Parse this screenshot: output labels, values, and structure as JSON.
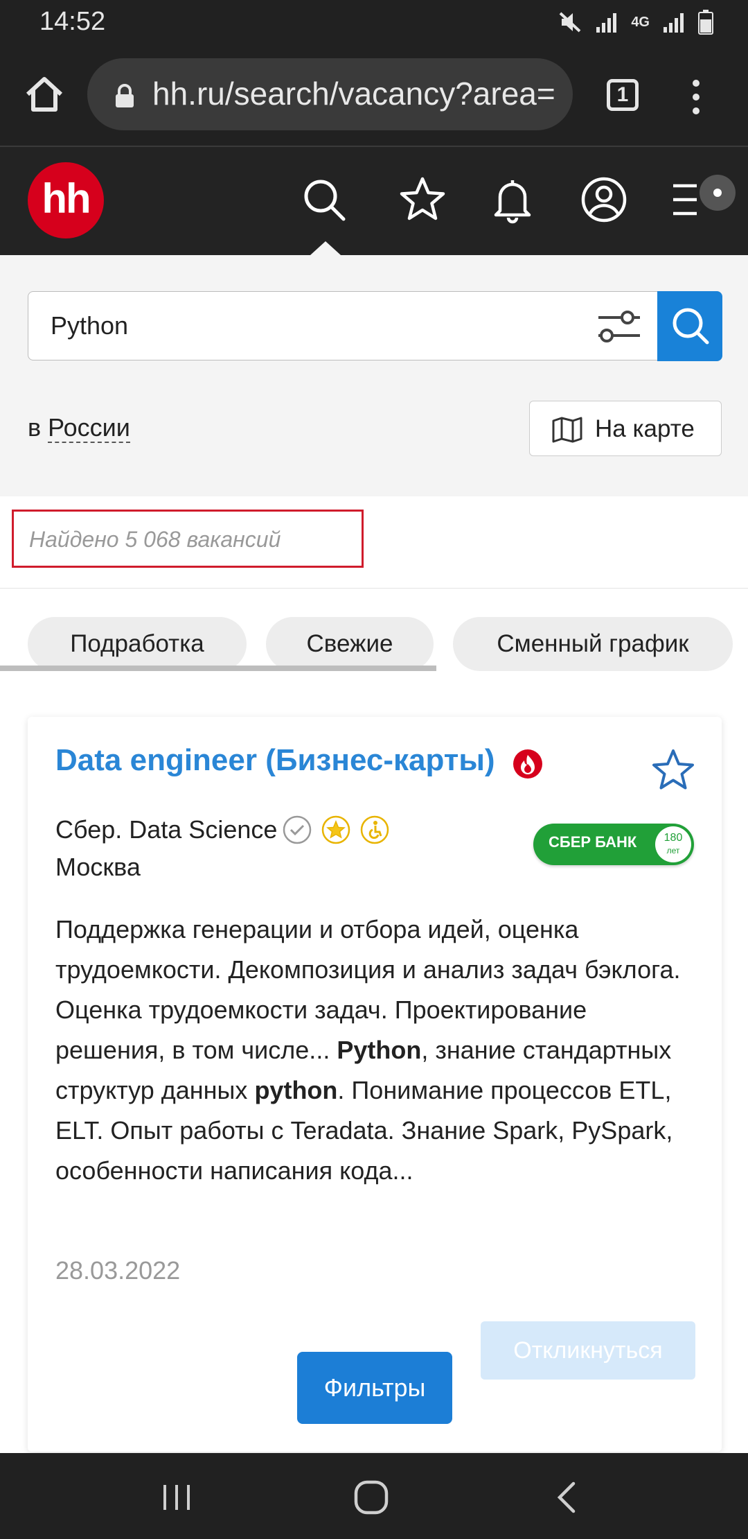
{
  "status_bar": {
    "time": "14:52",
    "network_label": "4G"
  },
  "browser": {
    "url": "hh.ru/search/vacancy?area=",
    "tab_count": "1"
  },
  "header": {
    "logo_text": "hh"
  },
  "search": {
    "query": "Python",
    "region_prefix": "в",
    "region_link": "России",
    "map_button": "На карте"
  },
  "results": {
    "found_text": "Найдено 5 068 вакансий"
  },
  "chips": [
    "Подработка",
    "Свежие",
    "Сменный график"
  ],
  "vacancy": {
    "title": "Data engineer (Бизнес-карты)",
    "company": "Сбер. Data Science",
    "city": "Москва",
    "employer_logo": {
      "name": "СБЕР БАНК",
      "badge_top": "180",
      "badge_bottom": "лет"
    },
    "desc_1": "Поддержка генерации и отбора идей, оценка трудоемкости. Декомпозиция и анализ задач бэклога. Оценка трудоемкости задач. Проектирование решения, в том числе...",
    "desc_hl1": "Python",
    "desc_2": ", знание стандартных структур данных ",
    "desc_hl2": "python",
    "desc_3": ". Понимание процессов ETL, ELT. Опыт работы с Teradata. Знание Spark, PySpark, особенности написания кода...",
    "date": "28.03.2022",
    "respond_button": "Откликнуться"
  },
  "filters_button": "Фильтры",
  "colors": {
    "accent": "#1982d8",
    "title_link": "#2a86d6",
    "logo_red": "#d6001c",
    "highlight_red": "#d01c2c"
  }
}
